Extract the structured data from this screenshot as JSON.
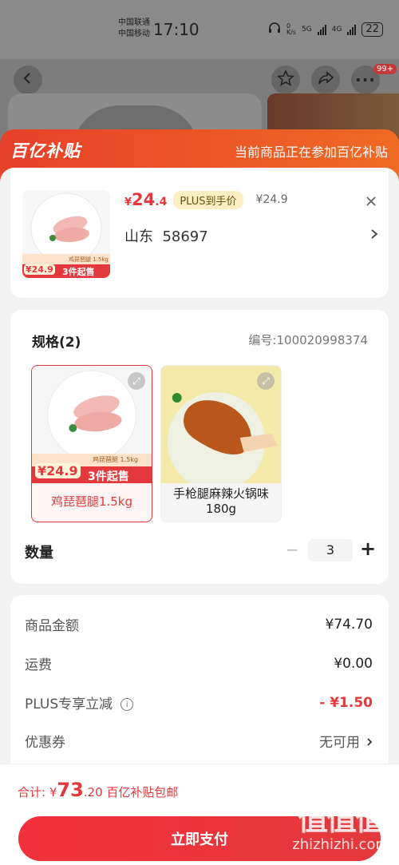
{
  "status_bar": {
    "carrier1": "中国联通",
    "carrier2": "中国移动",
    "time": "17:10",
    "net_speed": "0\nK/s",
    "net1": "5G",
    "net2": "4G",
    "battery": "22"
  },
  "header": {
    "badge": "99+"
  },
  "banner": {
    "logo": "百亿补贴",
    "notice": "当前商品正在参加百亿补贴"
  },
  "product": {
    "currency": "¥",
    "price_int": "24",
    "price_dec": ".4",
    "plus_tag": "PLUS到手价",
    "orig_price": "¥24.9",
    "address": "山东  58697",
    "thumb_price": "24.9",
    "thumb_tag": "3件起售",
    "thumb_spec": "鸡琵琶腿 1.5kg"
  },
  "spec": {
    "title": "规格(2)",
    "code": "编号:100020998374",
    "options": [
      {
        "label": "鸡琵琶腿1.5kg",
        "price": "24.9",
        "tag": "3件起售",
        "spec": "鸡琵琶腿 1.5kg",
        "selected": true
      },
      {
        "label": "手枪腿麻辣火锅味180g",
        "selected": false
      }
    ]
  },
  "quantity": {
    "label": "数量",
    "minus": "−",
    "value": "3",
    "plus": "+"
  },
  "fees": [
    {
      "label": "商品金额",
      "value": "¥74.70"
    },
    {
      "label": "运费",
      "value": "¥0.00"
    },
    {
      "label": "PLUS专享立减",
      "value": "- ¥1.50"
    },
    {
      "label": "优惠券",
      "value": "无可用"
    }
  ],
  "total": {
    "prefix": "合计: ¥",
    "int": "73",
    "dec": ".20",
    "suffix": " 百亿补贴包邮"
  },
  "pay_button": "立即支付",
  "watermark": {
    "logo": "值值值",
    "text": "zhizhizhi.com"
  },
  "colors": {
    "accent": "#e4393c",
    "banner_from": "#e6412a",
    "banner_to": "#f06a24"
  }
}
